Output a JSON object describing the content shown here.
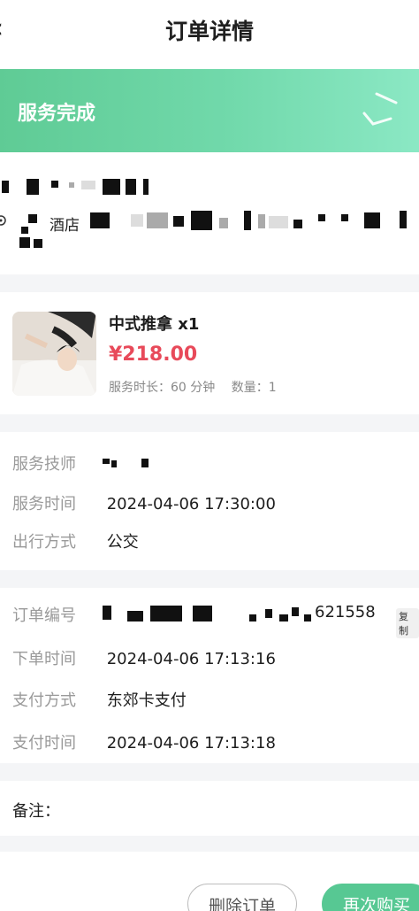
{
  "nav": {
    "title": "订单详情",
    "back_icon": "chevron-left-icon"
  },
  "status": {
    "text": "服务完成"
  },
  "address": {
    "hotel_label": "酒店"
  },
  "product": {
    "name": "中式推拿 x1",
    "price": "¥218.00",
    "duration": "服务时长：60 分钟",
    "quantity": "数量：1"
  },
  "service": {
    "technician_label": "服务技师",
    "time_label": "服务时间",
    "time_value": "2024-04-06 17:30:00",
    "travel_label": "出行方式",
    "travel_value": "公交"
  },
  "order": {
    "number_label": "订单编号",
    "number_tail": "621558",
    "copy_label": "复制",
    "placed_label": "下单时间",
    "placed_value": "2024-04-06 17:13:16",
    "pay_method_label": "支付方式",
    "pay_method_value": "东郊卡支付",
    "pay_time_label": "支付时间",
    "pay_time_value": "2024-04-06 17:13:18"
  },
  "remark": {
    "label": "备注："
  },
  "actions": {
    "delete_label": "删除订单",
    "rebuy_label": "再次购买"
  },
  "colors": {
    "accent": "#57c893",
    "price": "#e84a5a"
  }
}
